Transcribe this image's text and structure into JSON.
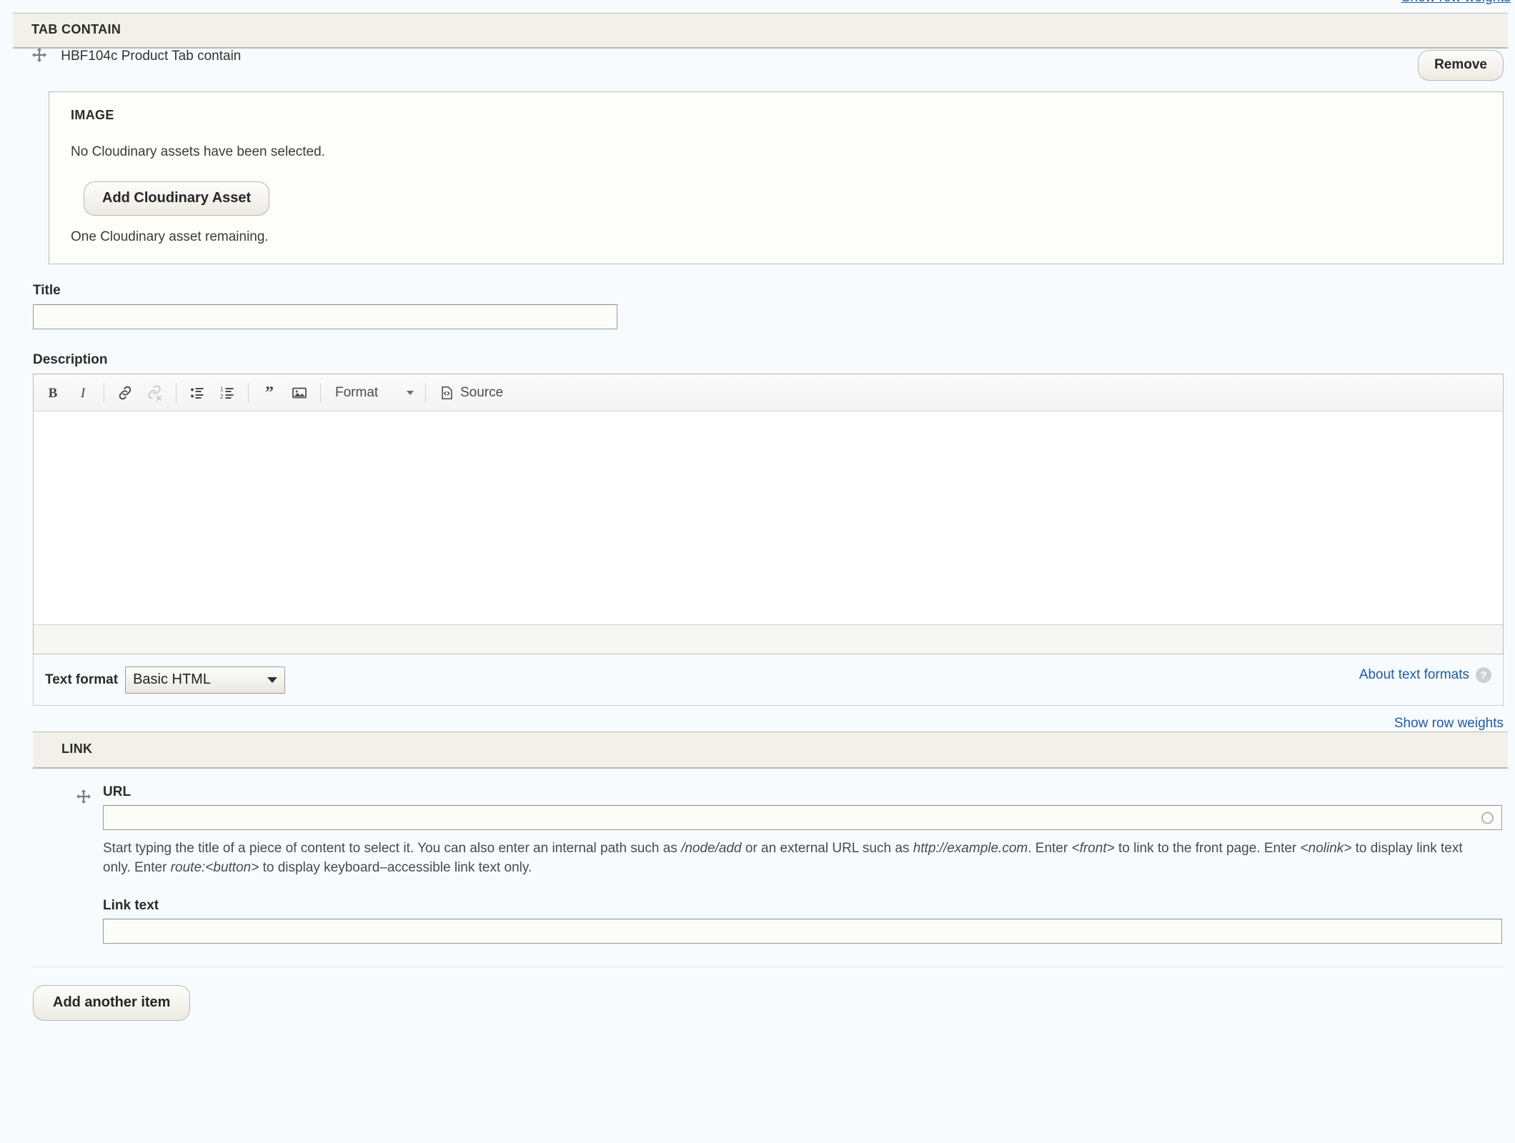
{
  "top": {
    "show_row_weights": "Show row weights"
  },
  "tab_contain": {
    "section_label": "TAB CONTAIN",
    "paragraph_title": "HBF104c Product Tab contain",
    "remove_label": "Remove",
    "drag_icon": "move-handle-icon"
  },
  "image_fieldset": {
    "legend": "IMAGE",
    "empty_message": "No Cloudinary assets have been selected.",
    "add_button": "Add Cloudinary Asset",
    "remaining_note": "One Cloudinary asset remaining."
  },
  "title_field": {
    "label": "Title",
    "value": "",
    "placeholder": ""
  },
  "description_field": {
    "label": "Description",
    "value": "",
    "toolbar": [
      {
        "name": "bold",
        "icon": "bold-icon",
        "label": "Bold",
        "disabled": false
      },
      {
        "name": "italic",
        "icon": "italic-icon",
        "label": "Italic",
        "disabled": false
      },
      {
        "name": "link",
        "icon": "link-icon",
        "label": "Link",
        "disabled": false
      },
      {
        "name": "unlink",
        "icon": "unlink-icon",
        "label": "Unlink",
        "disabled": true
      },
      {
        "name": "bulleted-list",
        "icon": "bulleted-list-icon",
        "label": "Bulleted list",
        "disabled": false
      },
      {
        "name": "numbered-list",
        "icon": "numbered-list-icon",
        "label": "Numbered list",
        "disabled": false
      },
      {
        "name": "blockquote",
        "icon": "blockquote-icon",
        "label": "Block quote",
        "disabled": false
      },
      {
        "name": "image",
        "icon": "image-icon",
        "label": "Image",
        "disabled": false
      }
    ],
    "format_combo_label": "Format",
    "source_label": "Source"
  },
  "text_format": {
    "label": "Text format",
    "selected": "Basic HTML",
    "options": [
      "Basic HTML"
    ],
    "about_link": "About text formats",
    "help_icon": "question-mark-icon"
  },
  "link_section": {
    "show_row_weights": "Show row weights",
    "section_label": "LINK",
    "drag_icon": "move-handle-icon",
    "url_label": "URL",
    "url_value": "",
    "url_throbber_icon": "autocomplete-throbber-icon",
    "url_description_parts": [
      {
        "text": "Start typing the title of a piece of content to select it. You can also enter an internal path such as ",
        "italic": false
      },
      {
        "text": "/node/add",
        "italic": true
      },
      {
        "text": " or an external URL such as ",
        "italic": false
      },
      {
        "text": "http://example.com",
        "italic": true
      },
      {
        "text": ". Enter ",
        "italic": false
      },
      {
        "text": "<front>",
        "italic": true
      },
      {
        "text": " to link to the front page. Enter ",
        "italic": false
      },
      {
        "text": "<nolink>",
        "italic": true
      },
      {
        "text": " to display link text only. Enter ",
        "italic": false
      },
      {
        "text": "route:<button>",
        "italic": true
      },
      {
        "text": " to display keyboard–accessible link text only.",
        "italic": false
      }
    ],
    "link_text_label": "Link text",
    "link_text_value": "",
    "add_another_label": "Add another item"
  },
  "colors": {
    "page_bg": "#f7fbfd",
    "header_bar_bg": "#f1f1ea",
    "fieldset_bg": "#fdfdfa",
    "link_blue": "#1f5ba6",
    "text": "#3b3b3b"
  }
}
